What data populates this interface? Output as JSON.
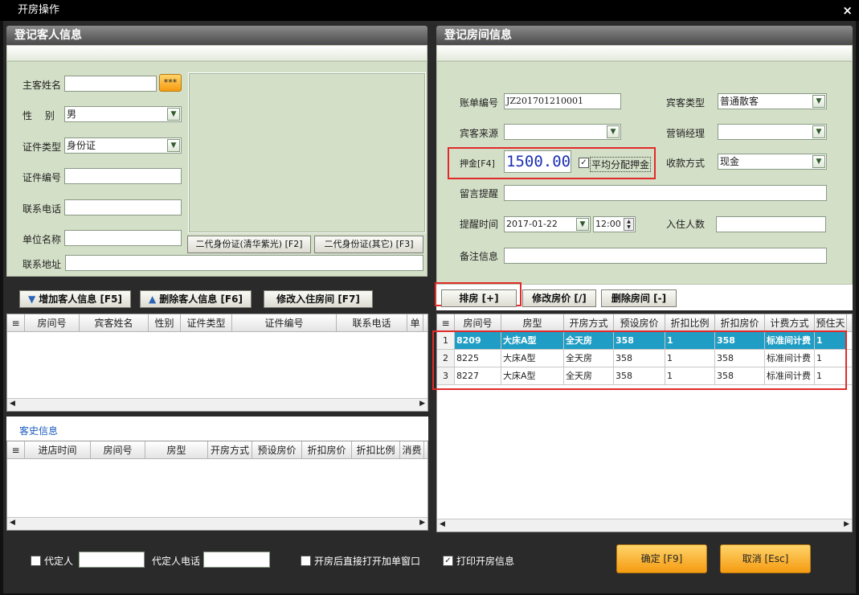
{
  "window": {
    "title": "开房操作",
    "close": "×"
  },
  "guest_panel": {
    "title": "登记客人信息",
    "name_label": "主客姓名",
    "name_value": "",
    "name_btn": "***",
    "gender_label": "性　 别",
    "gender_value": "男",
    "id_type_label": "证件类型",
    "id_type_value": "身份证",
    "id_no_label": "证件编号",
    "id_no_value": "",
    "phone_label": "联系电话",
    "phone_value": "",
    "company_label": "单位名称",
    "company_value": "",
    "address_label": "联系地址",
    "address_value": "",
    "id_btn_1": "二代身份证(清华紫光) [F2]",
    "id_btn_2": "二代身份证(其它) [F3]"
  },
  "guest_actions": {
    "add": "增加客人信息 [F5]",
    "delete": "删除客人信息 [F6]",
    "modify": "修改入住房间 [F7]"
  },
  "guest_table": {
    "headers": [
      "房间号",
      "宾客姓名",
      "性别",
      "证件类型",
      "证件编号",
      "联系电话",
      "单"
    ]
  },
  "history": {
    "title": "客史信息",
    "headers": [
      "进店时间",
      "房间号",
      "房型",
      "开房方式",
      "预设房价",
      "折扣房价",
      "折扣比例",
      "消费"
    ]
  },
  "room_panel": {
    "title": "登记房间信息",
    "bill_label": "账单编号",
    "bill_value": "JZ201701210001",
    "guest_type_label": "宾客类型",
    "guest_type_value": "普通散客",
    "source_label": "宾客来源",
    "source_value": "",
    "sales_label": "营销经理",
    "sales_value": "",
    "deposit_label": "押金[F4]",
    "deposit_value": "1500.00",
    "split_label": "平均分配押金",
    "pay_label": "收款方式",
    "pay_value": "现金",
    "message_label": "留言提醒",
    "message_value": "",
    "remind_label": "提醒时间",
    "remind_date": "2017-01-22",
    "remind_time": "12:00",
    "occupants_label": "入住人数",
    "occupants_value": "",
    "remark_label": "备注信息",
    "remark_value": ""
  },
  "room_actions": {
    "assign": "排房 [+]",
    "change_price": "修改房价 [/]",
    "delete_room": "删除房间 [-]"
  },
  "room_table": {
    "headers": [
      "房间号",
      "房型",
      "开房方式",
      "预设房价",
      "折扣比例",
      "折扣房价",
      "计费方式",
      "预住天"
    ],
    "rows": [
      {
        "n": "1",
        "room": "8209",
        "type": "大床A型",
        "mode": "全天房",
        "preset": "358",
        "ratio": "1",
        "discount": "358",
        "billing": "标准间计费",
        "days": "1"
      },
      {
        "n": "2",
        "room": "8225",
        "type": "大床A型",
        "mode": "全天房",
        "preset": "358",
        "ratio": "1",
        "discount": "358",
        "billing": "标准间计费",
        "days": "1"
      },
      {
        "n": "3",
        "room": "8227",
        "type": "大床A型",
        "mode": "全天房",
        "preset": "358",
        "ratio": "1",
        "discount": "358",
        "billing": "标准间计费",
        "days": "1"
      }
    ]
  },
  "footer": {
    "agent_label": "代定人",
    "agent_value": "",
    "agent_phone_label": "代定人电话",
    "agent_phone_value": "",
    "open_addon_label": "开房后直接打开加单窗口",
    "print_label": "打印开房信息",
    "confirm": "确定 [F9]",
    "cancel": "取消 [Esc]"
  }
}
